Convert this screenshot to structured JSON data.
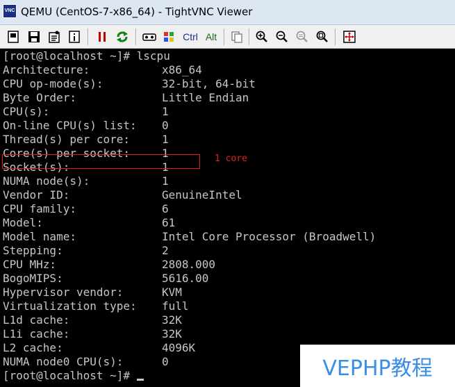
{
  "window": {
    "title": "QEMU (CentOS-7-x86_64) - TightVNC Viewer",
    "icon_label": "VNC"
  },
  "toolbar": {
    "ctrl_label": "Ctrl",
    "alt_label": "Alt"
  },
  "terminal": {
    "prompt_top": "[root@localhost ~]# lscpu",
    "rows": [
      {
        "label": "Architecture:",
        "value": "x86_64"
      },
      {
        "label": "CPU op-mode(s):",
        "value": "32-bit, 64-bit"
      },
      {
        "label": "Byte Order:",
        "value": "Little Endian"
      },
      {
        "label": "CPU(s):",
        "value": "1"
      },
      {
        "label": "On-line CPU(s) list:",
        "value": "0"
      },
      {
        "label": "Thread(s) per core:",
        "value": "1"
      },
      {
        "label": "Core(s) per socket:",
        "value": "1"
      },
      {
        "label": "Socket(s):",
        "value": "1"
      },
      {
        "label": "NUMA node(s):",
        "value": "1"
      },
      {
        "label": "Vendor ID:",
        "value": "GenuineIntel"
      },
      {
        "label": "CPU family:",
        "value": "6"
      },
      {
        "label": "Model:",
        "value": "61"
      },
      {
        "label": "Model name:",
        "value": "Intel Core Processor (Broadwell)"
      },
      {
        "label": "Stepping:",
        "value": "2"
      },
      {
        "label": "CPU MHz:",
        "value": "2808.000"
      },
      {
        "label": "BogoMIPS:",
        "value": "5616.00"
      },
      {
        "label": "Hypervisor vendor:",
        "value": "KVM"
      },
      {
        "label": "Virtualization type:",
        "value": "full"
      },
      {
        "label": "L1d cache:",
        "value": "32K"
      },
      {
        "label": "L1i cache:",
        "value": "32K"
      },
      {
        "label": "L2 cache:",
        "value": "4096K"
      },
      {
        "label": "NUMA node0 CPU(s):",
        "value": "0"
      }
    ],
    "prompt_bottom": "[root@localhost ~]# "
  },
  "annotation": {
    "text": "1 core",
    "color": "#e02020"
  },
  "watermark": {
    "text": "VEPHP教程",
    "color": "#3a8ee6"
  }
}
